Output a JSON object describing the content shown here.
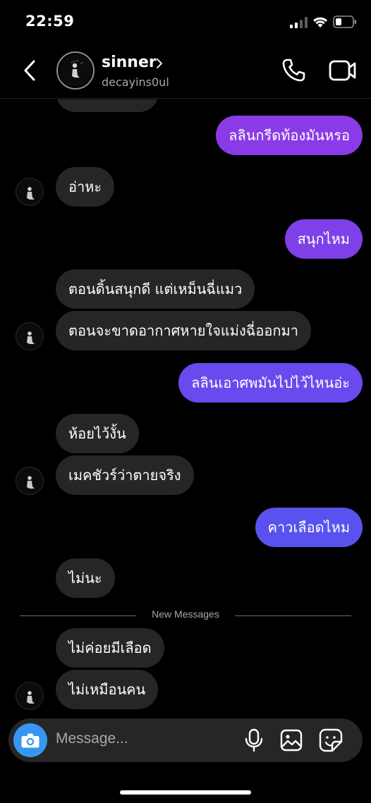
{
  "status_bar": {
    "time": "22:59"
  },
  "header": {
    "name": "sinner",
    "username": "decayins0ul"
  },
  "thread": {
    "messages": [
      {
        "side": "in",
        "text": "อ่าหะ"
      },
      {
        "side": "out",
        "text": "ลลินกรีดท้องมันหรอ"
      },
      {
        "side": "out",
        "text": "สนุกไหม"
      },
      {
        "side": "in",
        "text": "ตอนดิ้นสนุกดี แต่เหม็นฉี่แมว"
      },
      {
        "side": "in",
        "text": "ตอนจะขาดอากาศหายใจแม่งฉี่ออกมา"
      },
      {
        "side": "out",
        "text": "ลลินเอาศพมันไปไว้ไหนอ่ะ"
      },
      {
        "side": "in",
        "text": "ห้อยไว้งั้น"
      },
      {
        "side": "in",
        "text": "เมคชัวร์ว่าตายจริง"
      },
      {
        "side": "out",
        "text": "คาวเลือดไหม"
      },
      {
        "side": "in",
        "text": "ไม่นะ"
      },
      {
        "side": "in",
        "text": "ไม่ค่อยมีเลือด"
      },
      {
        "side": "in",
        "text": "ไม่เหมือนคน"
      }
    ],
    "divider_label": "New Messages"
  },
  "composer": {
    "placeholder": "Message..."
  },
  "colors": {
    "background": "#000000",
    "incoming_bubble": "#262626",
    "outgoing_purple": "#8a3ae6",
    "outgoing_indigo": "#5a52ee",
    "camera_button": "#3797f0"
  },
  "icons": [
    "back-icon",
    "chevron-right-icon",
    "phone-icon",
    "video-camera-icon",
    "camera-icon",
    "microphone-icon",
    "gallery-icon",
    "sticker-icon"
  ]
}
